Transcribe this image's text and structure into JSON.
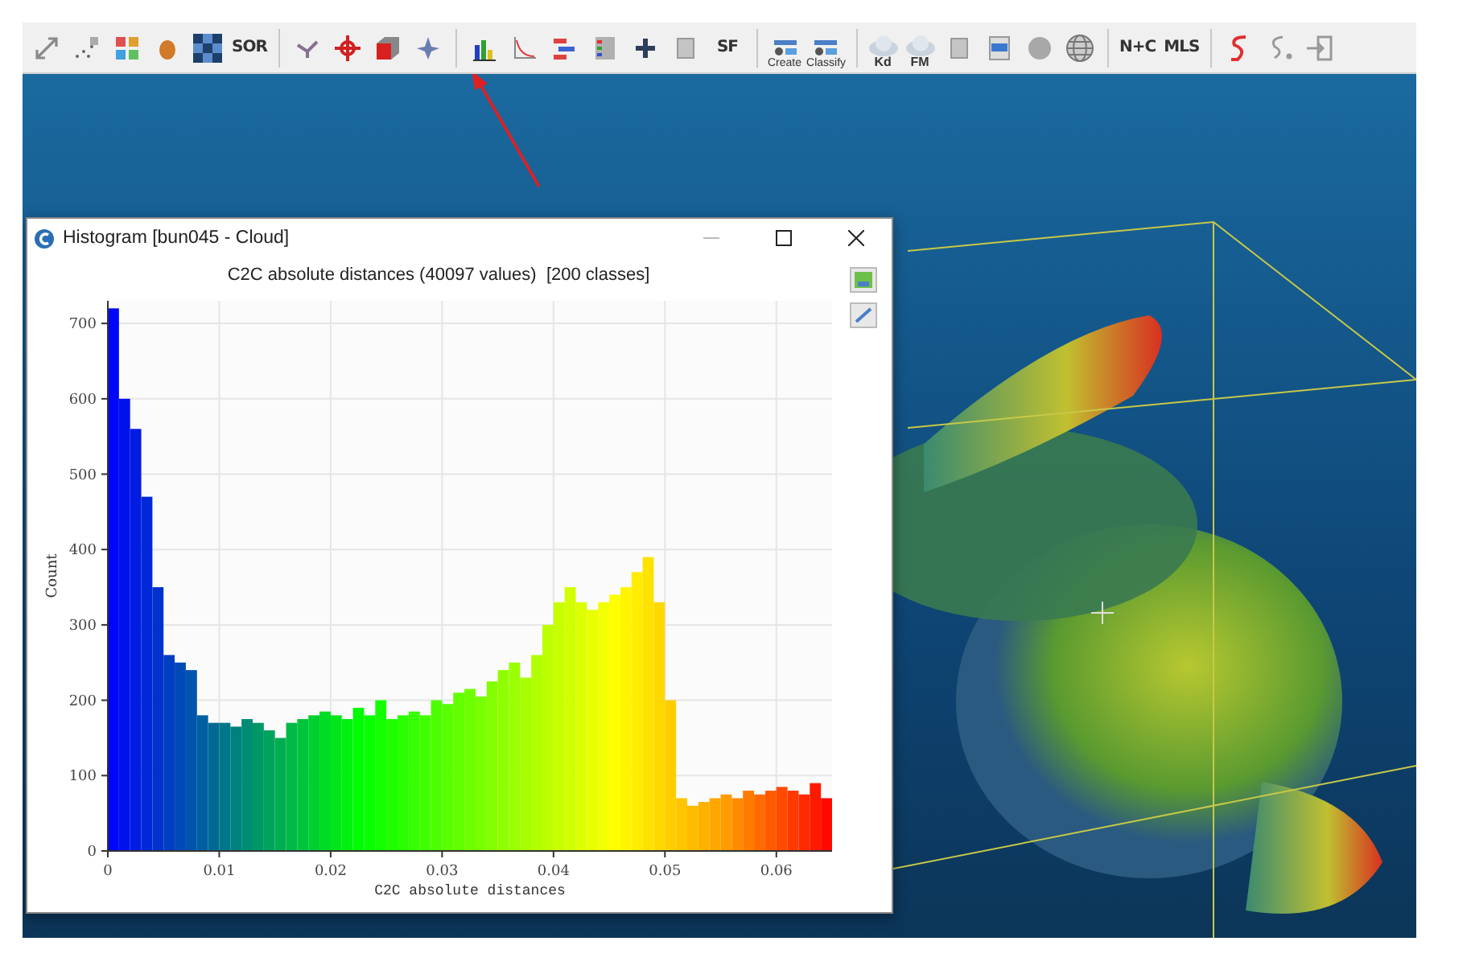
{
  "toolbar": [
    {
      "kind": "arrows"
    },
    {
      "kind": "dots"
    },
    {
      "kind": "grid"
    },
    {
      "kind": "blob"
    },
    {
      "kind": "checker"
    },
    {
      "kind": "label",
      "text": "SOR"
    },
    {
      "kind": "separator"
    },
    {
      "kind": "pen"
    },
    {
      "kind": "crosshair"
    },
    {
      "kind": "box"
    },
    {
      "kind": "star"
    },
    {
      "kind": "separator"
    },
    {
      "kind": "bars"
    },
    {
      "kind": "curve"
    },
    {
      "kind": "list"
    },
    {
      "kind": "palette"
    },
    {
      "kind": "plus"
    },
    {
      "kind": "doc"
    },
    {
      "kind": "label",
      "text": "SF"
    },
    {
      "kind": "separator"
    },
    {
      "kind": "canupo",
      "text": "Create"
    },
    {
      "kind": "canupo",
      "text": "Classify"
    },
    {
      "kind": "separator"
    },
    {
      "kind": "cloud",
      "text": "Kd"
    },
    {
      "kind": "cloud",
      "text": "FM"
    },
    {
      "kind": "doc"
    },
    {
      "kind": "bluedoc"
    },
    {
      "kind": "sphere"
    },
    {
      "kind": "mesh"
    },
    {
      "kind": "separator"
    },
    {
      "kind": "label",
      "text": "N+C"
    },
    {
      "kind": "label",
      "text": "MLS"
    },
    {
      "kind": "separator"
    },
    {
      "kind": "snake"
    },
    {
      "kind": "dotted"
    },
    {
      "kind": "import"
    }
  ],
  "histogram_window": {
    "title": "Histogram [bun045 - Cloud]",
    "chart_data": {
      "type": "bar",
      "title": "C2C absolute distances (40097 values)  [200 classes]",
      "xlabel": "C2C absolute distances",
      "ylabel": "Count",
      "x": [
        0.0005,
        0.0015,
        0.0025,
        0.0035,
        0.0045,
        0.0055,
        0.0065,
        0.0075,
        0.0085,
        0.0095,
        0.0105,
        0.0115,
        0.0125,
        0.0135,
        0.0145,
        0.0155,
        0.0165,
        0.0175,
        0.0185,
        0.0195,
        0.0205,
        0.0215,
        0.0225,
        0.0235,
        0.0245,
        0.0255,
        0.0265,
        0.0275,
        0.0285,
        0.0295,
        0.0305,
        0.0315,
        0.0325,
        0.0335,
        0.0345,
        0.0355,
        0.0365,
        0.0375,
        0.0385,
        0.0395,
        0.0405,
        0.0415,
        0.0425,
        0.0435,
        0.0445,
        0.0455,
        0.0465,
        0.0475,
        0.0485,
        0.0495,
        0.0505,
        0.0515,
        0.0525,
        0.0535,
        0.0545,
        0.0555,
        0.0565,
        0.0575,
        0.0585,
        0.0595,
        0.0605,
        0.0615,
        0.0625,
        0.0635,
        0.0645
      ],
      "grid": true,
      "values": [
        720,
        600,
        560,
        470,
        350,
        260,
        250,
        240,
        180,
        170,
        170,
        165,
        175,
        170,
        160,
        150,
        170,
        175,
        180,
        185,
        180,
        175,
        190,
        180,
        200,
        175,
        180,
        185,
        180,
        200,
        195,
        210,
        215,
        205,
        225,
        240,
        250,
        230,
        260,
        300,
        330,
        350,
        330,
        320,
        330,
        340,
        350,
        370,
        390,
        330,
        200,
        70,
        60,
        65,
        70,
        75,
        70,
        80,
        75,
        80,
        85,
        80,
        75,
        90,
        70
      ],
      "xlim": [
        0,
        0.065
      ],
      "ylim": [
        0,
        730
      ],
      "xticks": [
        0,
        0.01,
        0.02,
        0.03,
        0.04,
        0.05,
        0.06
      ],
      "yticks": [
        0,
        100,
        200,
        300,
        400,
        500,
        600,
        700
      ]
    }
  }
}
